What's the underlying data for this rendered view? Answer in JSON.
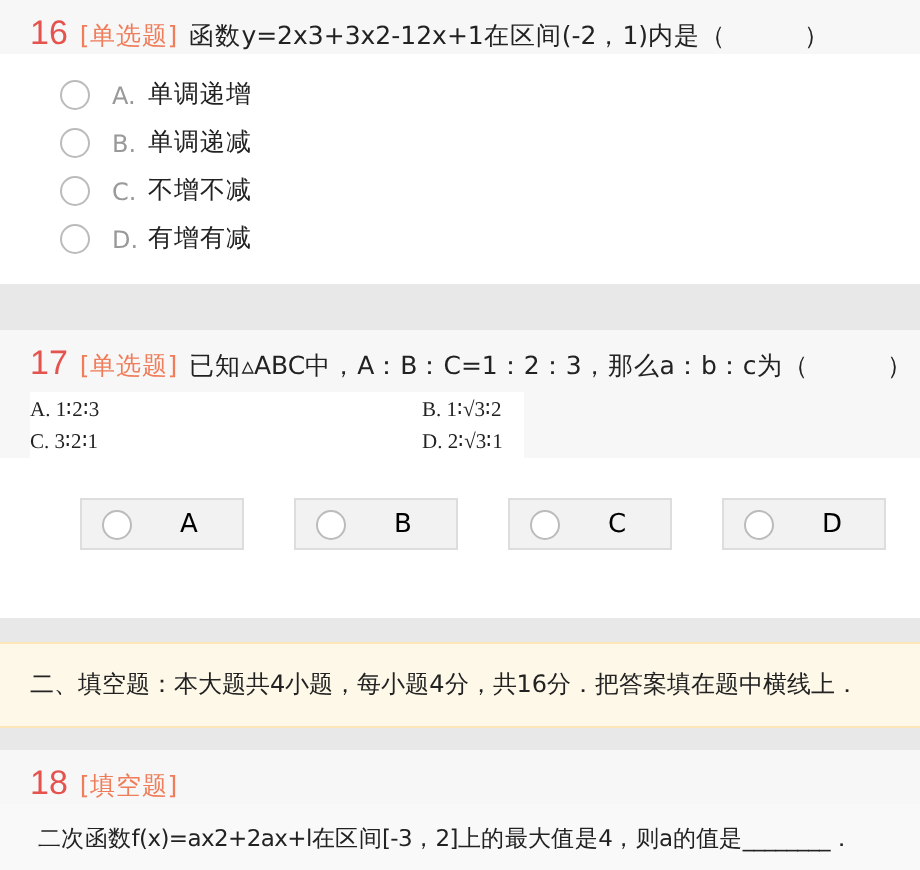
{
  "questions": [
    {
      "kind": "list",
      "number": "16",
      "type_label": "[单选题]",
      "stem": "函数y=2x3+3x2-12x+1在区间(-2，1)内是（　　　）",
      "options": [
        {
          "letter": "A.",
          "text": "单调递增",
          "selected": false
        },
        {
          "letter": "B.",
          "text": "单调递减",
          "selected": false
        },
        {
          "letter": "C.",
          "text": "不增不减",
          "selected": false
        },
        {
          "letter": "D.",
          "text": "有增有减",
          "selected": false
        }
      ]
    },
    {
      "kind": "buttons",
      "number": "17",
      "type_label": "[单选题]",
      "stem": "已知▵ABC中，A：B：C=1：2：3，那么a：b：c为（　　　）",
      "option_image": [
        "A. 1∶2∶3",
        "B. 1∶√3∶2",
        "C. 3∶2∶1",
        "D. 2∶√3∶1"
      ],
      "options": [
        {
          "letter": "A",
          "selected": false
        },
        {
          "letter": "B",
          "selected": false
        },
        {
          "letter": "C",
          "selected": false
        },
        {
          "letter": "D",
          "selected": false
        }
      ]
    },
    {
      "kind": "notice",
      "text": "二、填空题：本大题共4小题，每小题4分，共16分．把答案填在题中横线上．"
    },
    {
      "kind": "fill",
      "number": "18",
      "type_label": "[填空题]",
      "stem": "二次函数f(x)=ax2+2ax+l在区间[-3，2]上的最大值是4，则a的值是________．"
    }
  ]
}
